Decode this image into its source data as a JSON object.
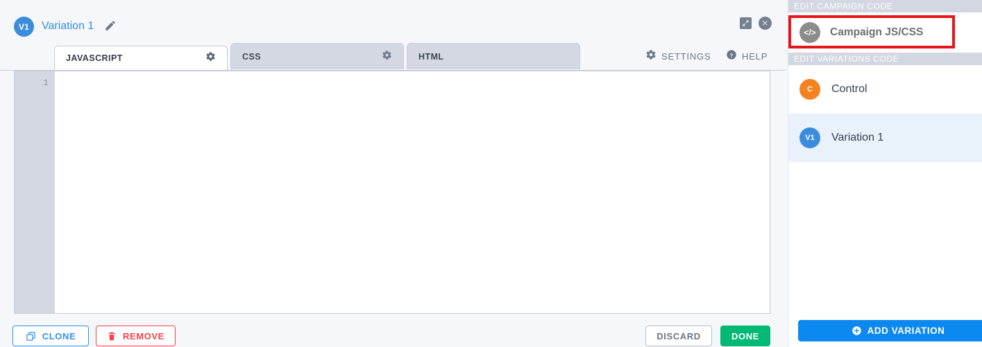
{
  "header": {
    "badge": "V1",
    "title": "Variation 1",
    "edit_icon": "pencil-icon",
    "expand_icon": "expand-icon",
    "close_icon": "close-icon"
  },
  "tabs": [
    {
      "label": "JAVASCRIPT",
      "active": true,
      "gear": true
    },
    {
      "label": "CSS",
      "active": false,
      "gear": true
    },
    {
      "label": "HTML",
      "active": false,
      "gear": false
    }
  ],
  "toolbar": {
    "settings_label": "SETTINGS",
    "settings_icon": "gear-icon",
    "help_label": "HELP",
    "help_icon": "question-circle-icon"
  },
  "editor": {
    "line_numbers": [
      "1"
    ],
    "content": "",
    "placeholder": ""
  },
  "actions": {
    "clone_label": "CLONE",
    "clone_icon": "copy-icon",
    "remove_label": "REMOVE",
    "remove_icon": "trash-icon",
    "discard_label": "DISCARD",
    "done_label": "DONE"
  },
  "sidebar": {
    "campaign_section_header": "EDIT CAMPAIGN CODE",
    "campaign_row": {
      "avatar": "</>",
      "label": "Campaign JS/CSS",
      "highlighted": true
    },
    "variations_section_header": "EDIT VARIATIONS CODE",
    "variations": [
      {
        "avatar": "C",
        "label": "Control",
        "selected": false
      },
      {
        "avatar": "V1",
        "label": "Variation 1",
        "selected": true
      }
    ],
    "add_variation_label": "ADD VARIATION",
    "add_variation_icon": "plus-circle-icon"
  },
  "colors": {
    "accent_blue": "#3a8ddd",
    "button_blue": "#0c89f0",
    "done_green": "#02b875",
    "remove_red": "#f9414a",
    "highlight_red": "#e8141b",
    "control_orange": "#f58220",
    "campaign_gray": "#8c8c8c"
  }
}
